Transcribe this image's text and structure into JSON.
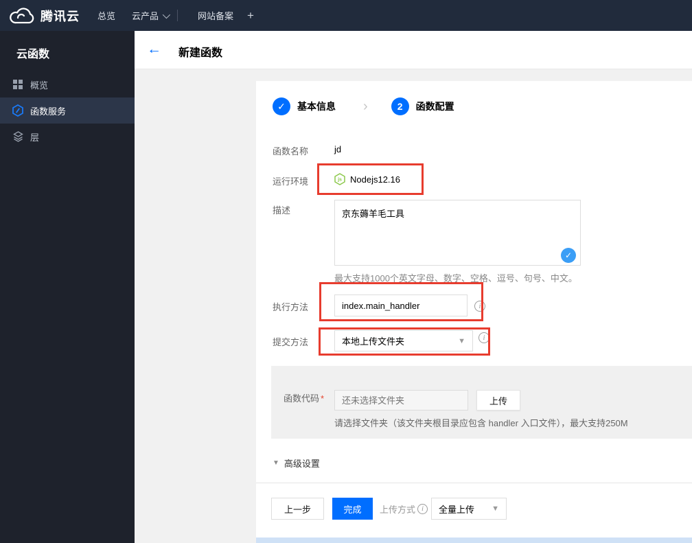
{
  "topbar": {
    "brand": "腾讯云",
    "nav_overview": "总览",
    "nav_products": "云产品",
    "nav_icp": "网站备案"
  },
  "sidebar": {
    "title": "云函数",
    "items": [
      {
        "label": "概览",
        "icon": "grid-icon",
        "active": false
      },
      {
        "label": "函数服务",
        "icon": "hexagon-function-icon",
        "active": true
      },
      {
        "label": "层",
        "icon": "layers-icon",
        "active": false
      }
    ]
  },
  "header": {
    "title": "新建函数"
  },
  "stepper": {
    "step1_label": "基本信息",
    "step2_number": "2",
    "step2_label": "函数配置"
  },
  "form": {
    "name_label": "函数名称",
    "name_value": "jd",
    "runtime_label": "运行环境",
    "runtime_value": "Nodejs12.16",
    "desc_label": "描述",
    "desc_value": "京东薅羊毛工具",
    "desc_hint": "最大支持1000个英文字母、数字、空格、逗号、句号、中文。",
    "handler_label": "执行方法",
    "handler_value": "index.main_handler",
    "submit_label": "提交方法",
    "submit_value": "本地上传文件夹",
    "code_label": "函数代码",
    "code_placeholder": "还未选择文件夹",
    "upload_button": "上传",
    "code_hint": "请选择文件夹（该文件夹根目录应包含 handler 入口文件），最大支持250M",
    "advanced_label": "高级设置"
  },
  "footer": {
    "prev_label": "上一步",
    "finish_label": "完成",
    "upload_mode_label": "上传方式",
    "upload_mode_value": "全量上传"
  },
  "icons": {
    "check": "✓",
    "info": "i",
    "plus": "+",
    "asterisk": "*",
    "arrow_left": "←",
    "step_chevron": "›",
    "caret_down": "▼",
    "triangle_down": "▼",
    "node_js_text": "js"
  },
  "colors": {
    "accent_blue": "#006eff",
    "annotation_red": "#e73c2e",
    "node_green": "#8cc84b",
    "check_badge_blue": "#3b9ef6",
    "topbar_bg": "#212b3c",
    "sidebar_bg": "#1e222c"
  }
}
